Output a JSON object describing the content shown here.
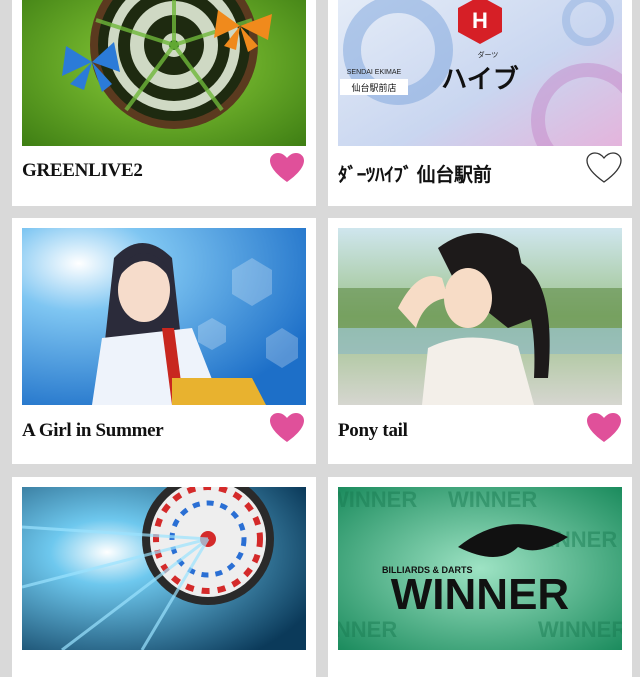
{
  "cards": [
    {
      "title": "GREENLIVE2",
      "favorite": true,
      "image": "darts-board-butterflies"
    },
    {
      "title": "ﾀﾞｰﾂﾊｲﾌﾞ 仙台駅前",
      "favorite": false,
      "image": "darts-hive-logo",
      "logo": {
        "letter": "H",
        "katakana": "ハイブ",
        "furigana": "ダーツ",
        "line1": "SENDAI EKIMAE",
        "line2": "仙台駅前店"
      }
    },
    {
      "title": "A Girl in Summer",
      "favorite": true,
      "image": "anime-schoolgirl"
    },
    {
      "title": "Pony tail",
      "favorite": true,
      "image": "anime-ponytail-girl"
    },
    {
      "title": "",
      "favorite": false,
      "image": "dartboard-blue-burst"
    },
    {
      "title": "",
      "favorite": false,
      "image": "winner-logo",
      "logo": {
        "top": "BILLIARDS & DARTS",
        "main": "WINNER",
        "bg": "WINNER"
      }
    }
  ],
  "colors": {
    "heart_on": "#e0509a",
    "heart_off": "#ffffff",
    "page_bg": "#d9d9d9"
  }
}
